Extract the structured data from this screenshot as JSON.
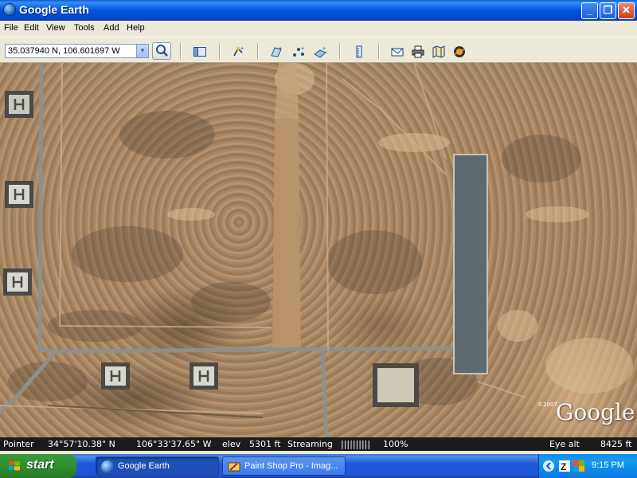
{
  "window": {
    "title": "Google Earth",
    "controls": {
      "minimize": "_",
      "maximize": "❐",
      "close": "✕"
    }
  },
  "menu": [
    "File",
    "Edit",
    "View",
    "Tools",
    "Add",
    "Help"
  ],
  "toolbar": {
    "search_value": "35.037940 N, 106.601697 W",
    "icons": [
      "search-icon",
      "sidebar-toggle-icon",
      "placemark-icon",
      "polygon-icon",
      "path-icon",
      "image-overlay-icon",
      "ruler-icon",
      "email-icon",
      "print-icon",
      "maps-icon",
      "sky-icon"
    ]
  },
  "map": {
    "watermark": "Google",
    "copyright": "©2007"
  },
  "status": {
    "pointer_label": "Pointer",
    "latitude": "34°57'10.38\" N",
    "longitude": "106°33'37.65\" W",
    "elev_label": "elev",
    "elev_value": "5301 ft",
    "streaming_label": "Streaming",
    "streaming_bars": "||||||||||",
    "streaming_percent": "100%",
    "eye_alt_label": "Eye alt",
    "eye_alt_value": "8425 ft"
  },
  "taskbar": {
    "start_label": "start",
    "tasks": [
      {
        "label": "Google Earth",
        "active": true
      },
      {
        "label": "Paint Shop Pro - Imag...",
        "active": false
      }
    ],
    "clock": "9:15 PM"
  },
  "colors": {
    "title_bar": "#0053E1",
    "taskbar": "#2157D7",
    "start_button": "#2F8F2F",
    "status_bar": "#1B1B1B",
    "runway": "#5F6A70",
    "terrain": "#A88A66"
  }
}
